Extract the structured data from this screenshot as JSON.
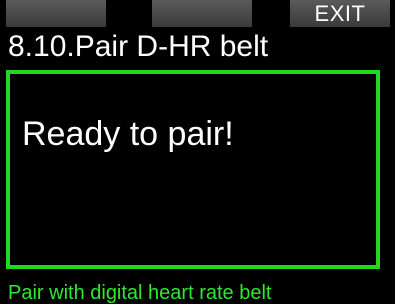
{
  "softkeys": {
    "left_label": "",
    "middle_label": "",
    "right_label": "EXIT"
  },
  "screen": {
    "title": "8.10.Pair D-HR belt",
    "message": "Ready to pair!",
    "status_text": "Pair with digital heart rate belt"
  },
  "colors": {
    "accent_green": "#1fd81f",
    "softkey_gray": "#4a4a4a",
    "background": "#000000"
  }
}
